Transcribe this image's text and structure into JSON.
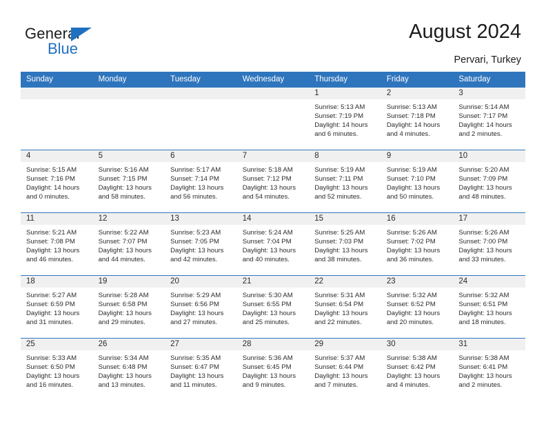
{
  "brand": {
    "name_part1": "General",
    "name_part2": "Blue",
    "logo_icon": "blue-triangle-icon",
    "accent_color": "#1f70c1"
  },
  "header": {
    "title": "August 2024",
    "location": "Pervari, Turkey",
    "header_bg_color": "#2f75bd",
    "header_text_color": "#ffffff"
  },
  "calendar": {
    "weekday_headers": [
      "Sunday",
      "Monday",
      "Tuesday",
      "Wednesday",
      "Thursday",
      "Friday",
      "Saturday"
    ],
    "labels": {
      "sunrise": "Sunrise:",
      "sunset": "Sunset:",
      "daylight": "Daylight:"
    },
    "weeks": [
      [
        {
          "day": ""
        },
        {
          "day": ""
        },
        {
          "day": ""
        },
        {
          "day": ""
        },
        {
          "day": "1",
          "sunrise": "Sunrise: 5:13 AM",
          "sunset": "Sunset: 7:19 PM",
          "daylight_line1": "Daylight: 14 hours",
          "daylight_line2": "and 6 minutes."
        },
        {
          "day": "2",
          "sunrise": "Sunrise: 5:13 AM",
          "sunset": "Sunset: 7:18 PM",
          "daylight_line1": "Daylight: 14 hours",
          "daylight_line2": "and 4 minutes."
        },
        {
          "day": "3",
          "sunrise": "Sunrise: 5:14 AM",
          "sunset": "Sunset: 7:17 PM",
          "daylight_line1": "Daylight: 14 hours",
          "daylight_line2": "and 2 minutes."
        }
      ],
      [
        {
          "day": "4",
          "sunrise": "Sunrise: 5:15 AM",
          "sunset": "Sunset: 7:16 PM",
          "daylight_line1": "Daylight: 14 hours",
          "daylight_line2": "and 0 minutes."
        },
        {
          "day": "5",
          "sunrise": "Sunrise: 5:16 AM",
          "sunset": "Sunset: 7:15 PM",
          "daylight_line1": "Daylight: 13 hours",
          "daylight_line2": "and 58 minutes."
        },
        {
          "day": "6",
          "sunrise": "Sunrise: 5:17 AM",
          "sunset": "Sunset: 7:14 PM",
          "daylight_line1": "Daylight: 13 hours",
          "daylight_line2": "and 56 minutes."
        },
        {
          "day": "7",
          "sunrise": "Sunrise: 5:18 AM",
          "sunset": "Sunset: 7:12 PM",
          "daylight_line1": "Daylight: 13 hours",
          "daylight_line2": "and 54 minutes."
        },
        {
          "day": "8",
          "sunrise": "Sunrise: 5:19 AM",
          "sunset": "Sunset: 7:11 PM",
          "daylight_line1": "Daylight: 13 hours",
          "daylight_line2": "and 52 minutes."
        },
        {
          "day": "9",
          "sunrise": "Sunrise: 5:19 AM",
          "sunset": "Sunset: 7:10 PM",
          "daylight_line1": "Daylight: 13 hours",
          "daylight_line2": "and 50 minutes."
        },
        {
          "day": "10",
          "sunrise": "Sunrise: 5:20 AM",
          "sunset": "Sunset: 7:09 PM",
          "daylight_line1": "Daylight: 13 hours",
          "daylight_line2": "and 48 minutes."
        }
      ],
      [
        {
          "day": "11",
          "sunrise": "Sunrise: 5:21 AM",
          "sunset": "Sunset: 7:08 PM",
          "daylight_line1": "Daylight: 13 hours",
          "daylight_line2": "and 46 minutes."
        },
        {
          "day": "12",
          "sunrise": "Sunrise: 5:22 AM",
          "sunset": "Sunset: 7:07 PM",
          "daylight_line1": "Daylight: 13 hours",
          "daylight_line2": "and 44 minutes."
        },
        {
          "day": "13",
          "sunrise": "Sunrise: 5:23 AM",
          "sunset": "Sunset: 7:05 PM",
          "daylight_line1": "Daylight: 13 hours",
          "daylight_line2": "and 42 minutes."
        },
        {
          "day": "14",
          "sunrise": "Sunrise: 5:24 AM",
          "sunset": "Sunset: 7:04 PM",
          "daylight_line1": "Daylight: 13 hours",
          "daylight_line2": "and 40 minutes."
        },
        {
          "day": "15",
          "sunrise": "Sunrise: 5:25 AM",
          "sunset": "Sunset: 7:03 PM",
          "daylight_line1": "Daylight: 13 hours",
          "daylight_line2": "and 38 minutes."
        },
        {
          "day": "16",
          "sunrise": "Sunrise: 5:26 AM",
          "sunset": "Sunset: 7:02 PM",
          "daylight_line1": "Daylight: 13 hours",
          "daylight_line2": "and 36 minutes."
        },
        {
          "day": "17",
          "sunrise": "Sunrise: 5:26 AM",
          "sunset": "Sunset: 7:00 PM",
          "daylight_line1": "Daylight: 13 hours",
          "daylight_line2": "and 33 minutes."
        }
      ],
      [
        {
          "day": "18",
          "sunrise": "Sunrise: 5:27 AM",
          "sunset": "Sunset: 6:59 PM",
          "daylight_line1": "Daylight: 13 hours",
          "daylight_line2": "and 31 minutes."
        },
        {
          "day": "19",
          "sunrise": "Sunrise: 5:28 AM",
          "sunset": "Sunset: 6:58 PM",
          "daylight_line1": "Daylight: 13 hours",
          "daylight_line2": "and 29 minutes."
        },
        {
          "day": "20",
          "sunrise": "Sunrise: 5:29 AM",
          "sunset": "Sunset: 6:56 PM",
          "daylight_line1": "Daylight: 13 hours",
          "daylight_line2": "and 27 minutes."
        },
        {
          "day": "21",
          "sunrise": "Sunrise: 5:30 AM",
          "sunset": "Sunset: 6:55 PM",
          "daylight_line1": "Daylight: 13 hours",
          "daylight_line2": "and 25 minutes."
        },
        {
          "day": "22",
          "sunrise": "Sunrise: 5:31 AM",
          "sunset": "Sunset: 6:54 PM",
          "daylight_line1": "Daylight: 13 hours",
          "daylight_line2": "and 22 minutes."
        },
        {
          "day": "23",
          "sunrise": "Sunrise: 5:32 AM",
          "sunset": "Sunset: 6:52 PM",
          "daylight_line1": "Daylight: 13 hours",
          "daylight_line2": "and 20 minutes."
        },
        {
          "day": "24",
          "sunrise": "Sunrise: 5:32 AM",
          "sunset": "Sunset: 6:51 PM",
          "daylight_line1": "Daylight: 13 hours",
          "daylight_line2": "and 18 minutes."
        }
      ],
      [
        {
          "day": "25",
          "sunrise": "Sunrise: 5:33 AM",
          "sunset": "Sunset: 6:50 PM",
          "daylight_line1": "Daylight: 13 hours",
          "daylight_line2": "and 16 minutes."
        },
        {
          "day": "26",
          "sunrise": "Sunrise: 5:34 AM",
          "sunset": "Sunset: 6:48 PM",
          "daylight_line1": "Daylight: 13 hours",
          "daylight_line2": "and 13 minutes."
        },
        {
          "day": "27",
          "sunrise": "Sunrise: 5:35 AM",
          "sunset": "Sunset: 6:47 PM",
          "daylight_line1": "Daylight: 13 hours",
          "daylight_line2": "and 11 minutes."
        },
        {
          "day": "28",
          "sunrise": "Sunrise: 5:36 AM",
          "sunset": "Sunset: 6:45 PM",
          "daylight_line1": "Daylight: 13 hours",
          "daylight_line2": "and 9 minutes."
        },
        {
          "day": "29",
          "sunrise": "Sunrise: 5:37 AM",
          "sunset": "Sunset: 6:44 PM",
          "daylight_line1": "Daylight: 13 hours",
          "daylight_line2": "and 7 minutes."
        },
        {
          "day": "30",
          "sunrise": "Sunrise: 5:38 AM",
          "sunset": "Sunset: 6:42 PM",
          "daylight_line1": "Daylight: 13 hours",
          "daylight_line2": "and 4 minutes."
        },
        {
          "day": "31",
          "sunrise": "Sunrise: 5:38 AM",
          "sunset": "Sunset: 6:41 PM",
          "daylight_line1": "Daylight: 13 hours",
          "daylight_line2": "and 2 minutes."
        }
      ]
    ]
  }
}
